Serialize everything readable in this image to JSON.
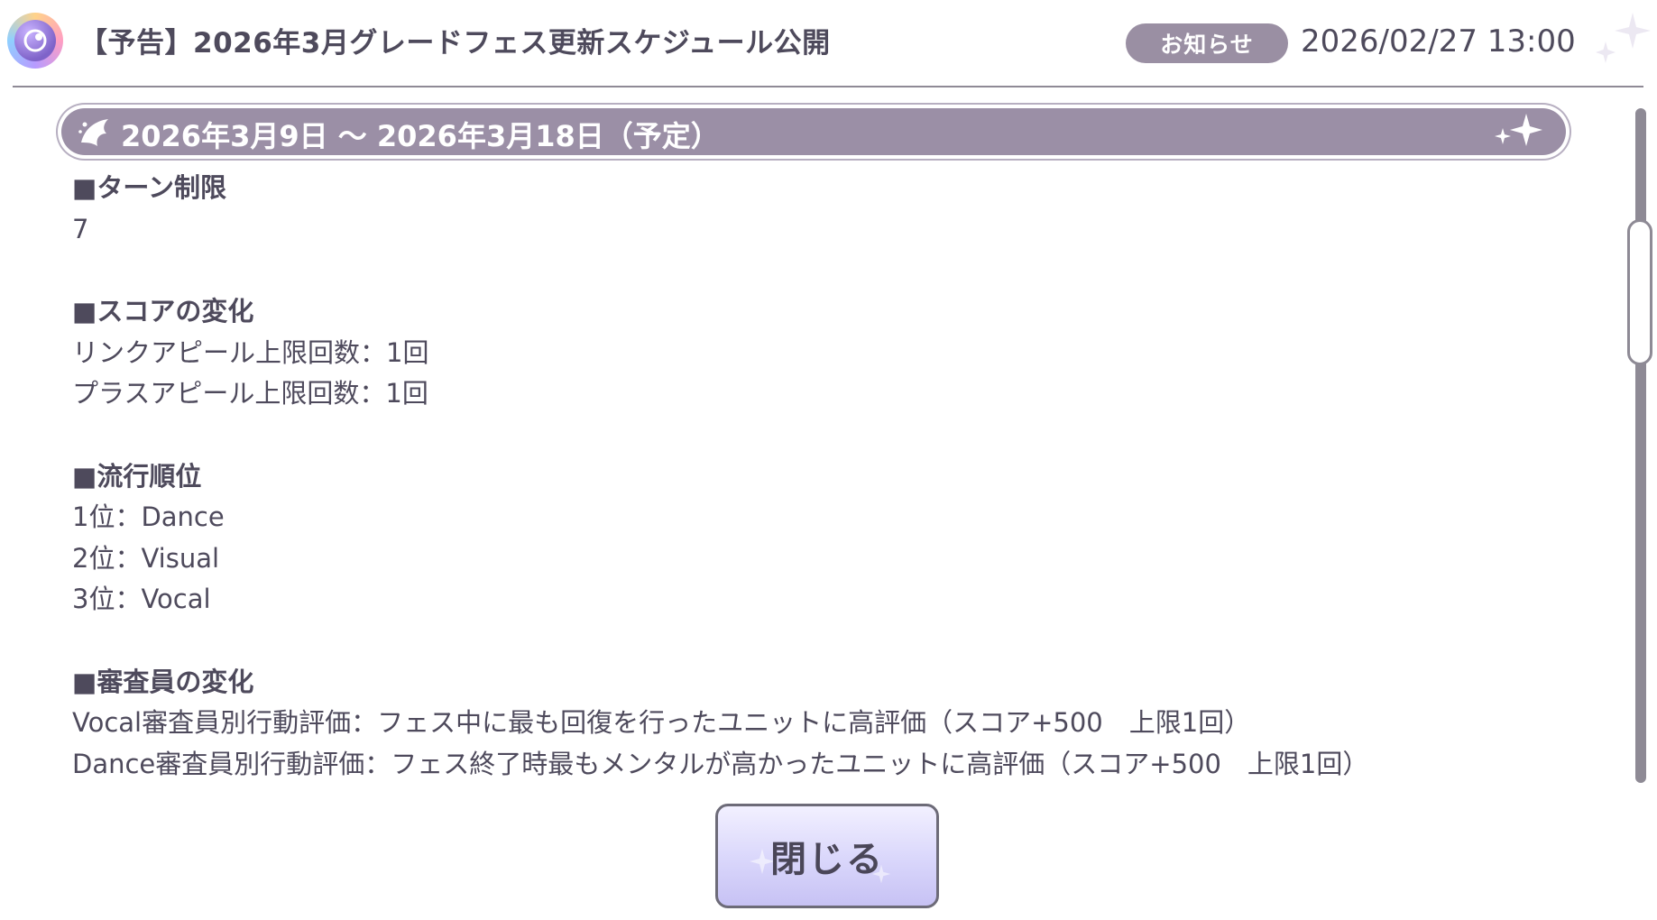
{
  "header": {
    "title": "【予告】2026年3月グレードフェス更新スケジュール公開",
    "badge": "お知らせ",
    "date": "2026/02/27 13:00",
    "icon": "idol-logo-icon",
    "sparkle_icon": "sparkle-icon"
  },
  "banner": {
    "text": "2026年3月9日 ～ 2026年3月18日（予定）",
    "icon": "wing-icon",
    "sparkle_icon": "sparkle-icon"
  },
  "sections": [
    {
      "heading": "■ターン制限",
      "lines": [
        "7"
      ]
    },
    {
      "heading": "■スコアの変化",
      "lines": [
        "リンクアピール上限回数：1回",
        "プラスアピール上限回数：1回"
      ]
    },
    {
      "heading": "■流行順位",
      "lines": [
        "1位：Dance",
        "2位：Visual",
        "3位：Vocal"
      ]
    },
    {
      "heading": "■審査員の変化",
      "lines": [
        "Vocal審査員別行動評価：フェス中に最も回復を行ったユニットに高評価（スコア+500　上限1回）",
        "Dance審査員別行動評価：フェス終了時最もメンタルが高かったユニットに高評価（スコア+500　上限1回）"
      ]
    }
  ],
  "footer": {
    "close_label": "閉じる"
  },
  "colors": {
    "banner": "#9b8fa6",
    "badge": "#9a8fa3",
    "text": "#4e4a5c",
    "button": "#d9d6fb"
  }
}
